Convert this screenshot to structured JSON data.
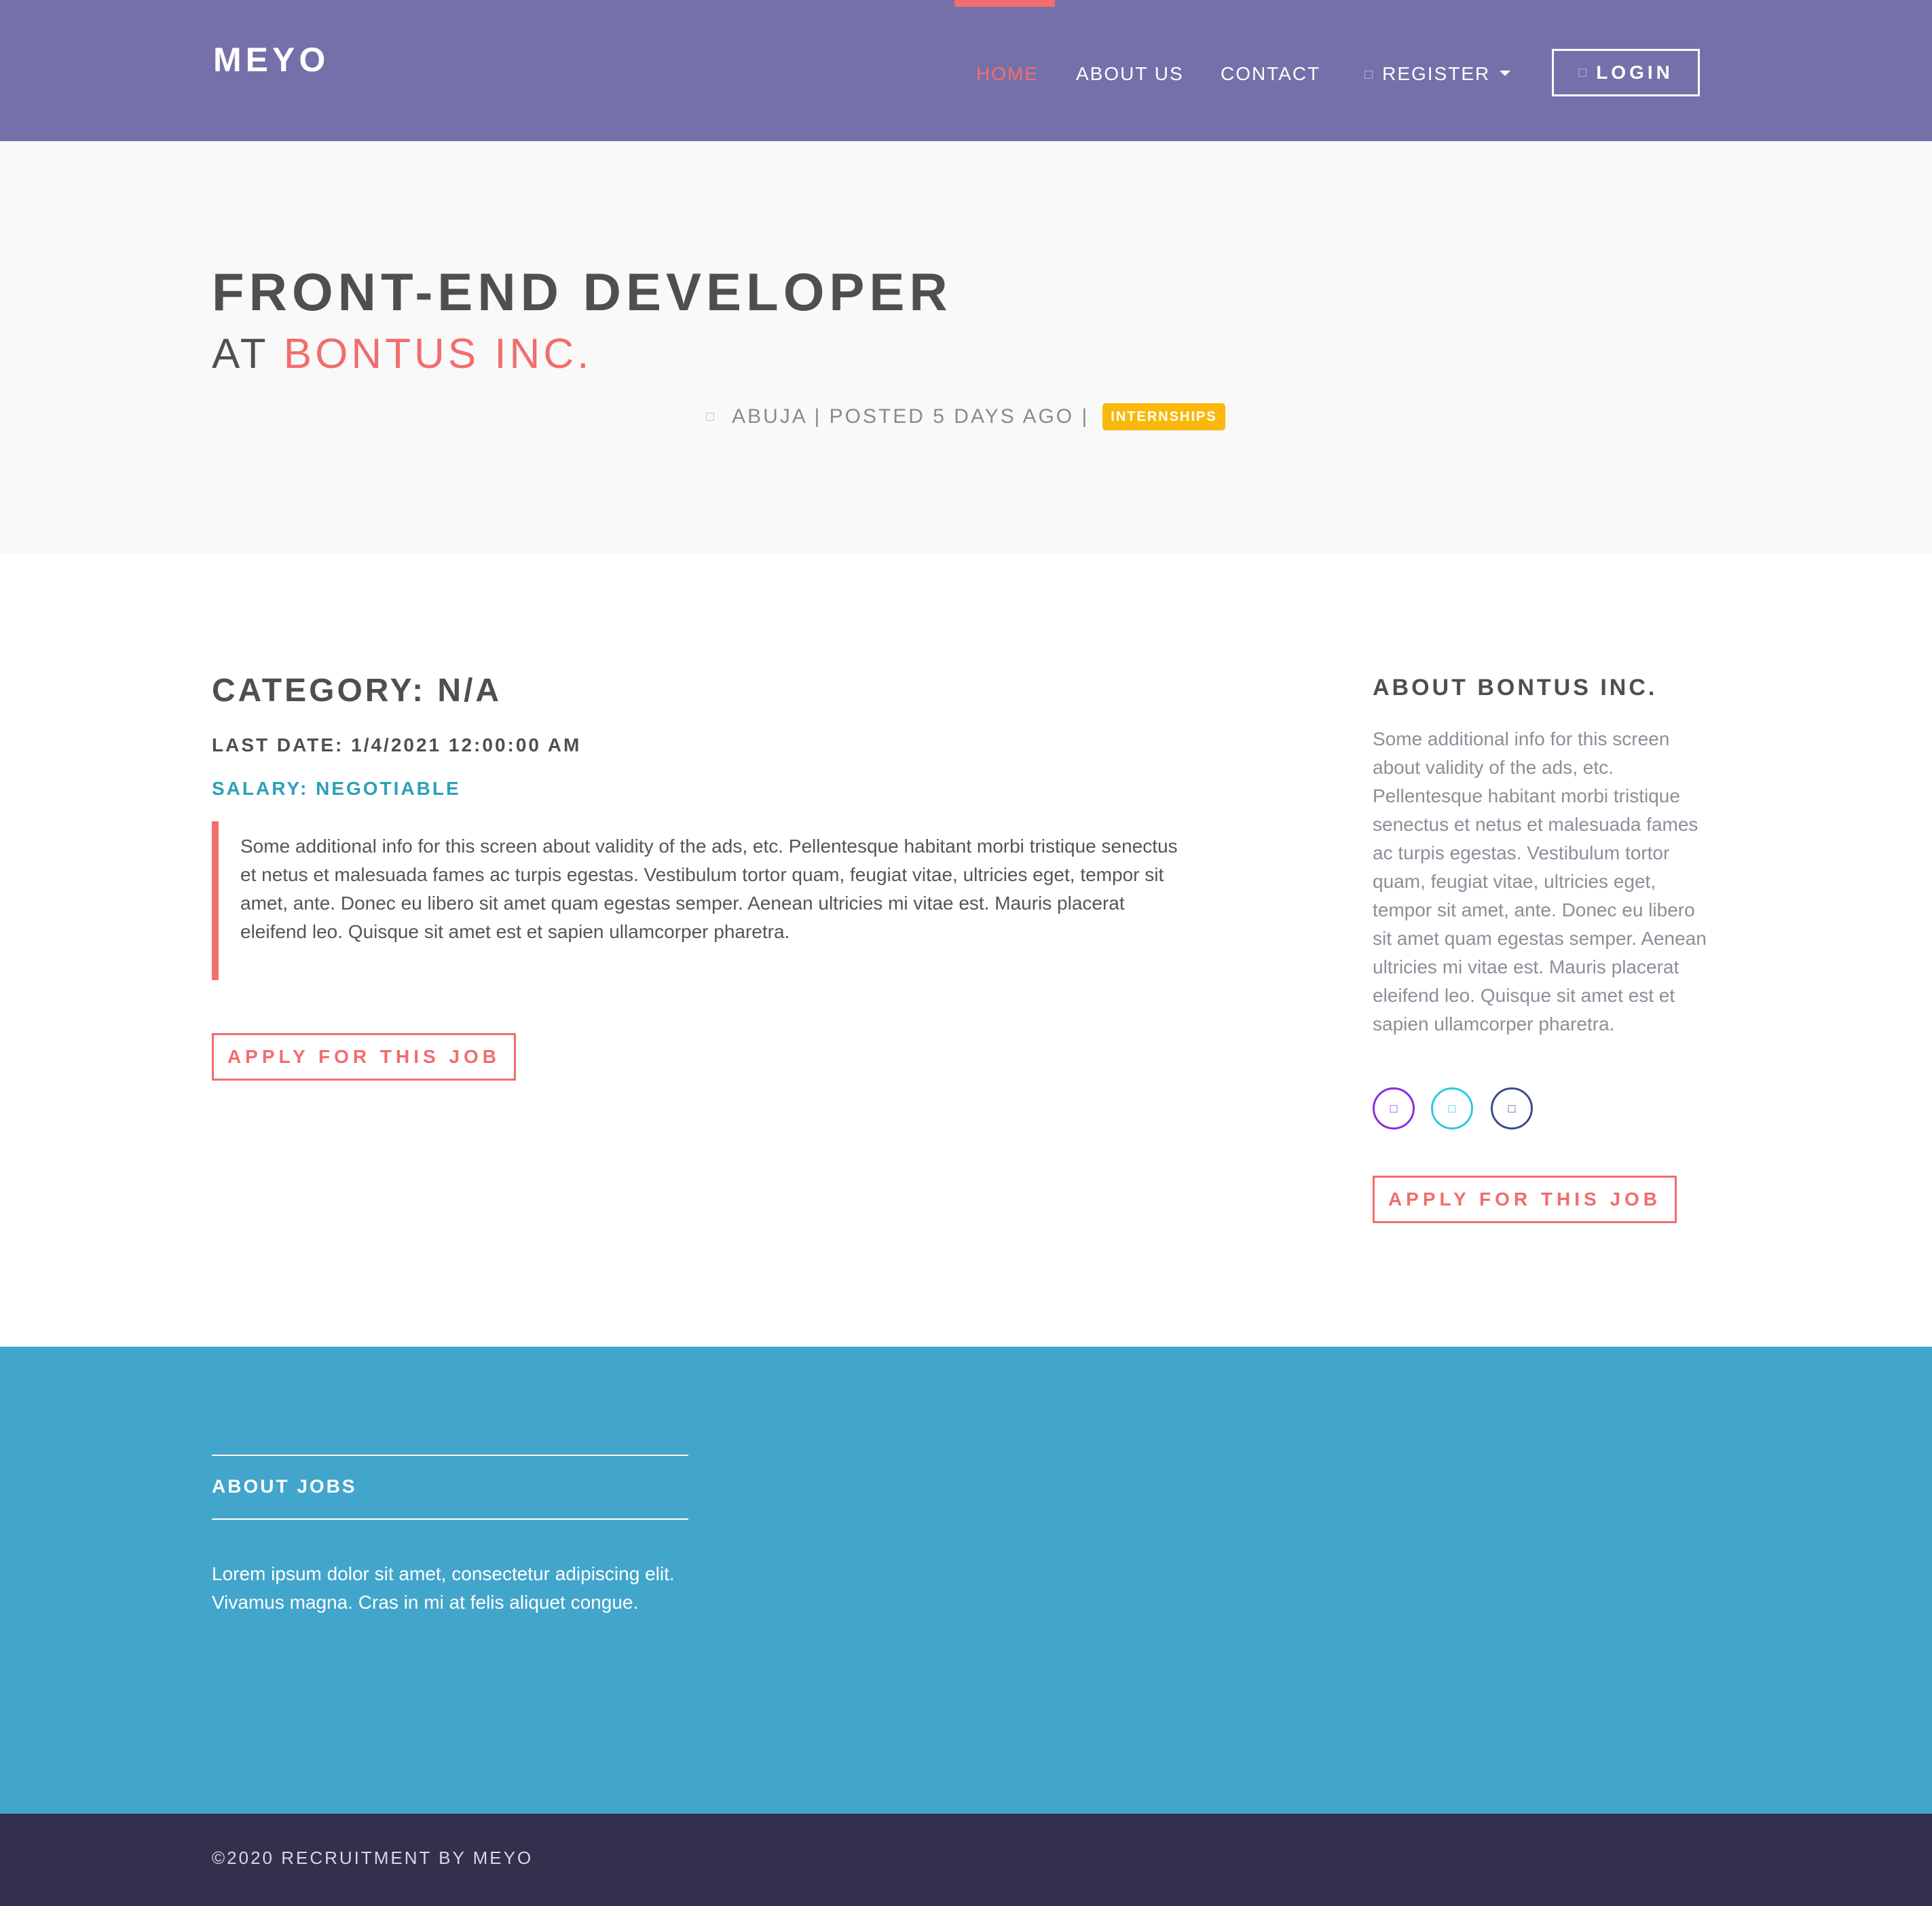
{
  "header": {
    "brand": "MEYO",
    "nav": {
      "home": "HOME",
      "about": "ABOUT US",
      "contact": "CONTACT",
      "register": "REGISTER",
      "login": "LOGIN"
    },
    "active_item": "HOME",
    "icons": {
      "register": "user-plus-icon",
      "login": "sign-in-icon",
      "register_dropdown": "caret-down-icon"
    },
    "colors": {
      "background": "#7570a9",
      "accent": "#f26d6d"
    }
  },
  "hero": {
    "title": "FRONT-END DEVELOPER",
    "at_prefix": "AT",
    "company": "BONTUS INC.",
    "location_icon": "map-pin-icon",
    "meta": "ABUJA | POSTED 5 DAYS AGO |",
    "badge": "INTERNSHIPS",
    "badge_color": "#f9b80b"
  },
  "job": {
    "category": "CATEGORY: N/A",
    "last_date": "LAST DATE: 1/4/2021 12:00:00 AM",
    "salary": "SALARY: NEGOTIABLE",
    "description": "Some additional info for this screen about validity of the ads, etc. Pellentesque habitant morbi tristique senectus et netus et malesuada fames ac turpis egestas. Vestibulum tortor quam, feugiat vitae, ultricies eget, tempor sit amet, ante. Donec eu libero sit amet quam egestas semper. Aenean ultricies mi vitae est. Mauris placerat eleifend leo. Quisque sit amet est et sapien ullamcorper pharetra.",
    "apply_label": "APPLY FOR THIS JOB"
  },
  "sidebar": {
    "title": "ABOUT BONTUS INC.",
    "text": "Some additional info for this screen about validity of the ads, etc. Pellentesque habitant morbi tristique senectus et netus et malesuada fames ac turpis egestas. Vestibulum tortor quam, feugiat vitae, ultricies eget, tempor sit amet, ante. Donec eu libero sit amet quam egestas semper. Aenean ultricies mi vitae est. Mauris placerat eleifend leo. Quisque sit amet est et sapien ullamcorper pharetra.",
    "social": [
      {
        "icon": "instagram-icon",
        "color": "#8a2be2"
      },
      {
        "icon": "twitter-icon",
        "color": "#2ec8e0"
      },
      {
        "icon": "facebook-icon",
        "color": "#3d4a8c"
      }
    ],
    "apply_label": "APPLY FOR THIS JOB"
  },
  "footer": {
    "heading": "ABOUT JOBS",
    "text": "Lorem ipsum dolor sit amet, consectetur adipiscing elit. Vivamus magna. Cras in mi at felis aliquet congue.",
    "copyright": "©2020 RECRUITMENT BY MEYO",
    "colors": {
      "background": "#42a5cb",
      "bottom_bar": "#332f4d"
    }
  }
}
